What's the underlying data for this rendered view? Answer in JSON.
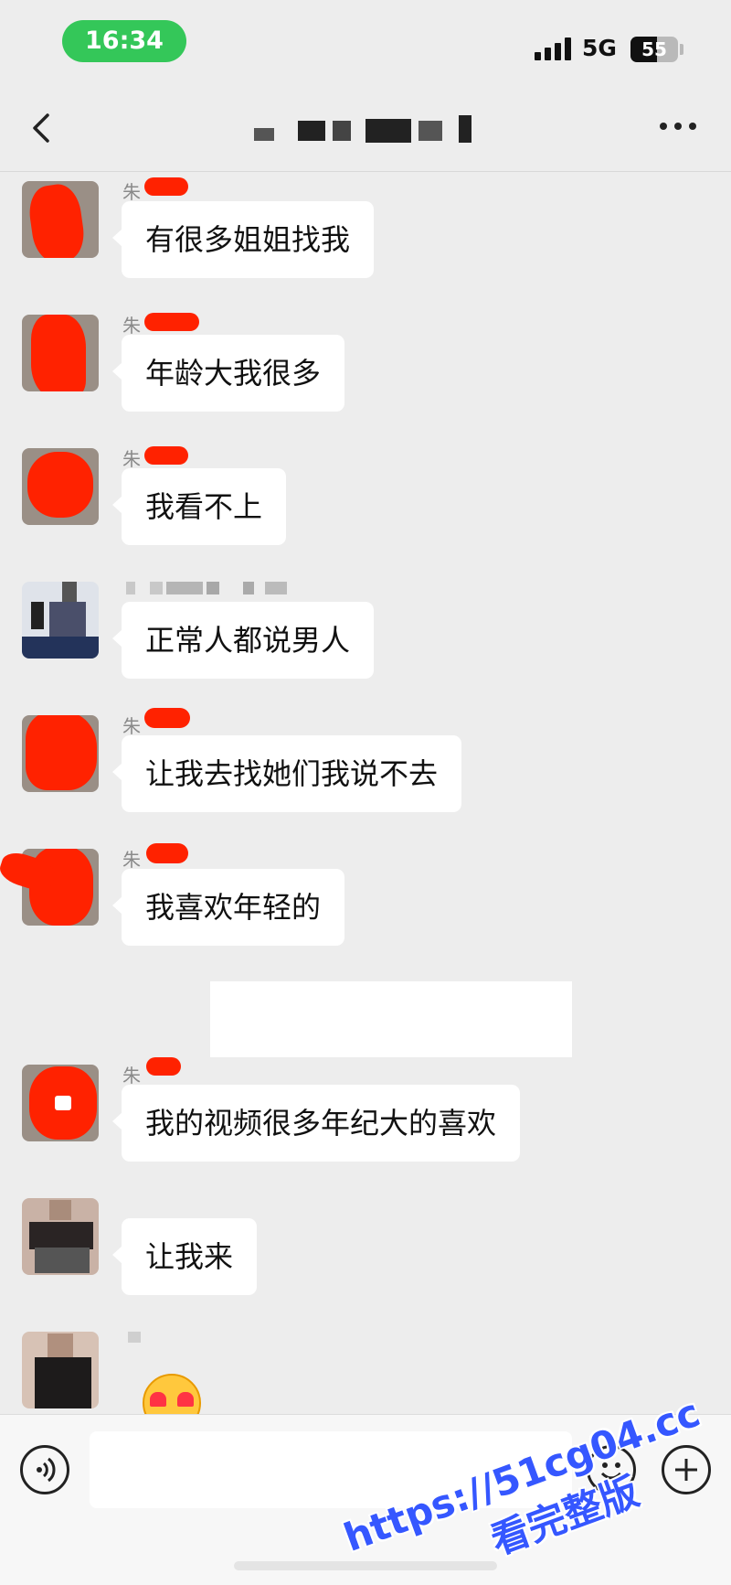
{
  "status": {
    "time": "16:34",
    "network": "5G",
    "battery": "55",
    "battery_level": 0.55
  },
  "nav": {
    "title": ""
  },
  "messages": [
    {
      "sender": "朱",
      "text": "有很多姐姐找我"
    },
    {
      "sender": "朱",
      "text": "年龄大我很多"
    },
    {
      "sender": "朱",
      "text": "我看不上"
    },
    {
      "sender": "",
      "text": "正常人都说男人"
    },
    {
      "sender": "朱",
      "text": "让我去找她们我说不去"
    },
    {
      "sender": "朱",
      "text": "我喜欢年轻的"
    },
    {
      "sender": "朱",
      "text": "我的视频很多年纪大的喜欢"
    },
    {
      "sender": "",
      "text": "让我来"
    }
  ],
  "last_message": {
    "emoji": "heart-eyes-emoji"
  },
  "input": {
    "placeholder": ""
  },
  "watermark": {
    "url": "https://51cg04.cc",
    "sub": "看完整版"
  },
  "colors": {
    "background": "#ededed",
    "bubble": "#ffffff",
    "time_pill": "#34c759",
    "redaction": "#ff2200",
    "watermark": "#3557ff"
  }
}
